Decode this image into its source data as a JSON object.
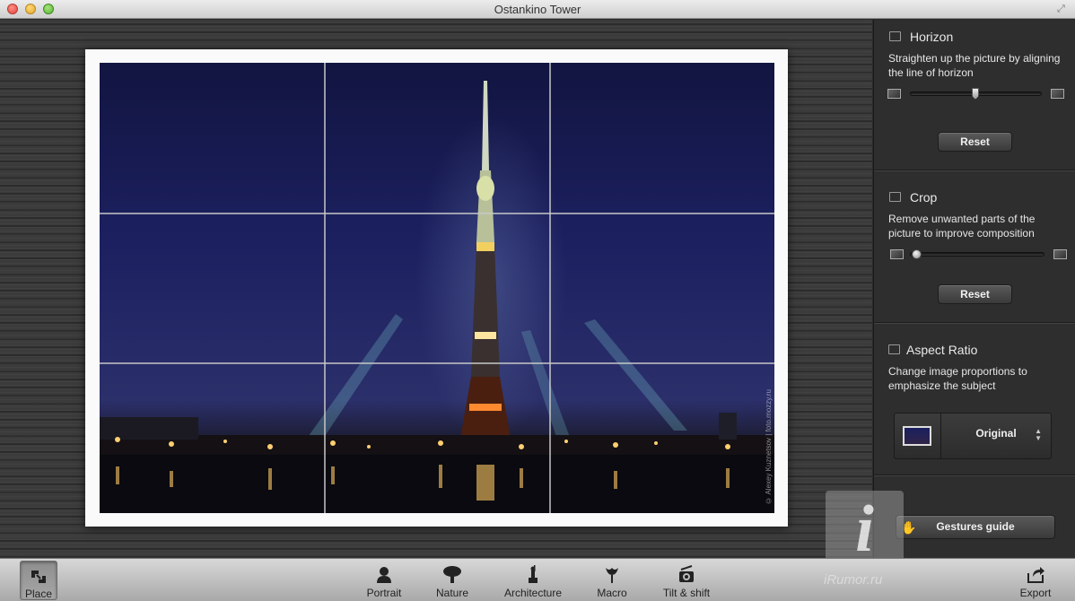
{
  "window": {
    "title": "Ostankino Tower"
  },
  "photo": {
    "watermark": "© Alexey Kuznetsov | foto.mozzy.ru"
  },
  "panel": {
    "horizon": {
      "title": "Horizon",
      "description": "Straighten up the picture by aligning the line of horizon",
      "slider_value": 0.5,
      "reset_label": "Reset"
    },
    "crop": {
      "title": "Crop",
      "description": "Remove unwanted parts of the picture to improve composition",
      "slider_value": 0.0,
      "reset_label": "Reset"
    },
    "aspect_ratio": {
      "title": "Aspect Ratio",
      "description": "Change image proportions to emphasize the subject",
      "selected": "Original"
    },
    "gestures_label": "Gestures guide"
  },
  "toolbar": {
    "place": "Place",
    "portrait": "Portrait",
    "nature": "Nature",
    "architecture": "Architecture",
    "macro": "Macro",
    "tilt_shift": "Tilt & shift",
    "export": "Export"
  },
  "overlay": {
    "brand": "iRumor.ru",
    "brand_letter": "i"
  },
  "colors": {
    "panel_bg": "#2e2e2e",
    "toolbar_bg": "#bdbdbd",
    "sky": "#1c2060"
  }
}
